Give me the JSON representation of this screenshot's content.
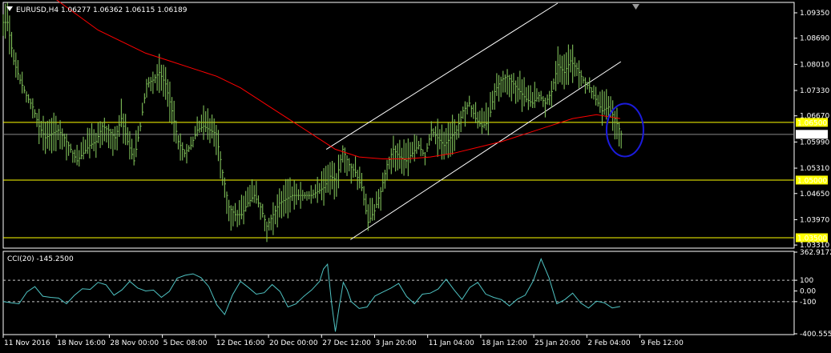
{
  "window": {
    "symbol_line": "EURUSD,H4  1.06277 1.06362 1.06115 1.06189",
    "indicator_line": "CCI(20) -145.2500"
  },
  "colors": {
    "background": "#000000",
    "frame": "#ffffff",
    "bars": "#7fbf59",
    "moving_average": "#ff0000",
    "horizontal_levels": "#ffff00",
    "channel": "#ffffff",
    "cci_line": "#4fc3c3",
    "circle": "#1b1bdc",
    "current_price_line": "#8a8a8a"
  },
  "chart_data": [
    {
      "type": "line",
      "name": "price-panel",
      "title": "EURUSD,H4  1.06277 1.06362 1.06115 1.06189",
      "x_ticks": [
        "11 Nov 2016",
        "18 Nov 16:00",
        "28 Nov 00:00",
        "5 Dec 08:00",
        "12 Dec 16:00",
        "20 Dec 00:00",
        "27 Dec 12:00",
        "3 Jan 20:00",
        "11 Jan 04:00",
        "18 Jan 12:00",
        "25 Jan 20:00",
        "2 Feb 04:00",
        "9 Feb 12:00"
      ],
      "y_ticks": [
        "1.09350",
        "1.08690",
        "1.08010",
        "1.07330",
        "1.06670",
        "1.05990",
        "1.05310",
        "1.04650",
        "1.03970",
        "1.03310"
      ],
      "ylim": [
        1.0325,
        1.096
      ],
      "levels": [
        {
          "label": "1.06500",
          "value": 1.065
        },
        {
          "label": "1.05000",
          "value": 1.05
        },
        {
          "label": "1.03500",
          "value": 1.035
        }
      ],
      "current_price": {
        "label": "1.06189",
        "value": 1.06189
      },
      "channel_lines": [
        {
          "from": [
            0.4085,
            1.058
          ],
          "to": [
            0.701,
            1.096
          ]
        },
        {
          "from": [
            0.439,
            1.0345
          ],
          "to": [
            0.781,
            1.0808
          ]
        }
      ],
      "series": [
        {
          "name": "EURUSD",
          "style": "bars",
          "x": [
            0.0,
            0.008,
            0.016,
            0.024,
            0.032,
            0.04,
            0.048,
            0.056,
            0.064,
            0.072,
            0.08,
            0.088,
            0.096,
            0.104,
            0.112,
            0.12,
            0.128,
            0.136,
            0.144,
            0.152,
            0.16,
            0.168,
            0.176,
            0.184,
            0.192,
            0.2,
            0.208,
            0.216,
            0.224,
            0.232,
            0.24,
            0.248,
            0.256,
            0.264,
            0.272,
            0.28,
            0.288,
            0.296,
            0.304,
            0.312,
            0.32,
            0.328,
            0.336,
            0.344,
            0.352,
            0.36,
            0.368,
            0.376,
            0.384,
            0.392,
            0.4,
            0.408,
            0.416,
            0.424,
            0.432,
            0.44,
            0.448,
            0.456,
            0.464,
            0.472,
            0.48,
            0.488,
            0.496,
            0.504,
            0.512,
            0.52,
            0.528,
            0.536,
            0.544,
            0.552,
            0.56,
            0.568,
            0.576,
            0.584,
            0.592,
            0.6,
            0.608,
            0.616,
            0.624,
            0.632,
            0.64,
            0.648,
            0.656,
            0.664,
            0.672,
            0.68,
            0.688,
            0.696,
            0.704,
            0.712,
            0.72,
            0.728,
            0.736,
            0.744,
            0.752,
            0.76,
            0.768,
            0.776
          ],
          "values": [
            1.091,
            1.081,
            1.076,
            1.072,
            1.069,
            1.064,
            1.061,
            1.062,
            1.063,
            1.061,
            1.058,
            1.055,
            1.057,
            1.059,
            1.06,
            1.064,
            1.063,
            1.061,
            1.066,
            1.06,
            1.055,
            1.064,
            1.075,
            1.076,
            1.078,
            1.075,
            1.068,
            1.06,
            1.057,
            1.059,
            1.063,
            1.064,
            1.063,
            1.062,
            1.052,
            1.043,
            1.041,
            1.041,
            1.044,
            1.046,
            1.043,
            1.038,
            1.041,
            1.044,
            1.045,
            1.046,
            1.046,
            1.046,
            1.046,
            1.047,
            1.048,
            1.051,
            1.05,
            1.058,
            1.054,
            1.052,
            1.048,
            1.039,
            1.042,
            1.047,
            1.054,
            1.058,
            1.056,
            1.055,
            1.057,
            1.059,
            1.056,
            1.063,
            1.061,
            1.059,
            1.061,
            1.063,
            1.068,
            1.07,
            1.066,
            1.064,
            1.065,
            1.073,
            1.076,
            1.077,
            1.075,
            1.073,
            1.071,
            1.07,
            1.072,
            1.07,
            1.073,
            1.08,
            1.078,
            1.081,
            1.079,
            1.076,
            1.074,
            1.071,
            1.068,
            1.069,
            1.066,
            1.062
          ]
        },
        {
          "name": "moving average",
          "style": "line",
          "x": [
            0.0,
            0.06,
            0.12,
            0.18,
            0.21,
            0.24,
            0.27,
            0.3,
            0.33,
            0.36,
            0.39,
            0.42,
            0.45,
            0.48,
            0.51,
            0.54,
            0.57,
            0.6,
            0.63,
            0.66,
            0.69,
            0.72,
            0.75,
            0.78
          ],
          "values": [
            1.104,
            1.098,
            1.089,
            1.083,
            1.081,
            1.079,
            1.077,
            1.074,
            1.07,
            1.066,
            1.062,
            1.058,
            1.056,
            1.0555,
            1.0555,
            1.056,
            1.057,
            1.0585,
            1.06,
            1.062,
            1.064,
            1.066,
            1.067,
            1.066
          ]
        }
      ]
    },
    {
      "type": "line",
      "name": "cci-panel",
      "title": "CCI(20) -145.2500",
      "y_ticks": [
        "362.9172",
        "100",
        "0.00",
        "-100",
        "-400.5550"
      ],
      "ylim": [
        -400.555,
        362.9172
      ],
      "levels": [
        100,
        -100
      ],
      "series": [
        {
          "name": "CCI(20)",
          "x": [
            0.0,
            0.02,
            0.04,
            0.06,
            0.08,
            0.1,
            0.12,
            0.14,
            0.16,
            0.18,
            0.2,
            0.22,
            0.24,
            0.26,
            0.28,
            0.3,
            0.32,
            0.34,
            0.36,
            0.38,
            0.4,
            0.41,
            0.42,
            0.43,
            0.44,
            0.46,
            0.48,
            0.5,
            0.52,
            0.54,
            0.56,
            0.58,
            0.6,
            0.62,
            0.64,
            0.66,
            0.68,
            0.7,
            0.72,
            0.74,
            0.76,
            0.78
          ],
          "values": [
            -100,
            -120,
            40,
            -60,
            -120,
            20,
            80,
            -40,
            90,
            0,
            -60,
            120,
            160,
            40,
            -220,
            90,
            -30,
            60,
            -150,
            -50,
            90,
            250,
            -380,
            80,
            -100,
            -150,
            -10,
            70,
            -120,
            -20,
            110,
            -80,
            80,
            -60,
            -140,
            -40,
            300,
            -120,
            -20,
            -160,
            -110,
            -145
          ]
        }
      ]
    }
  ]
}
